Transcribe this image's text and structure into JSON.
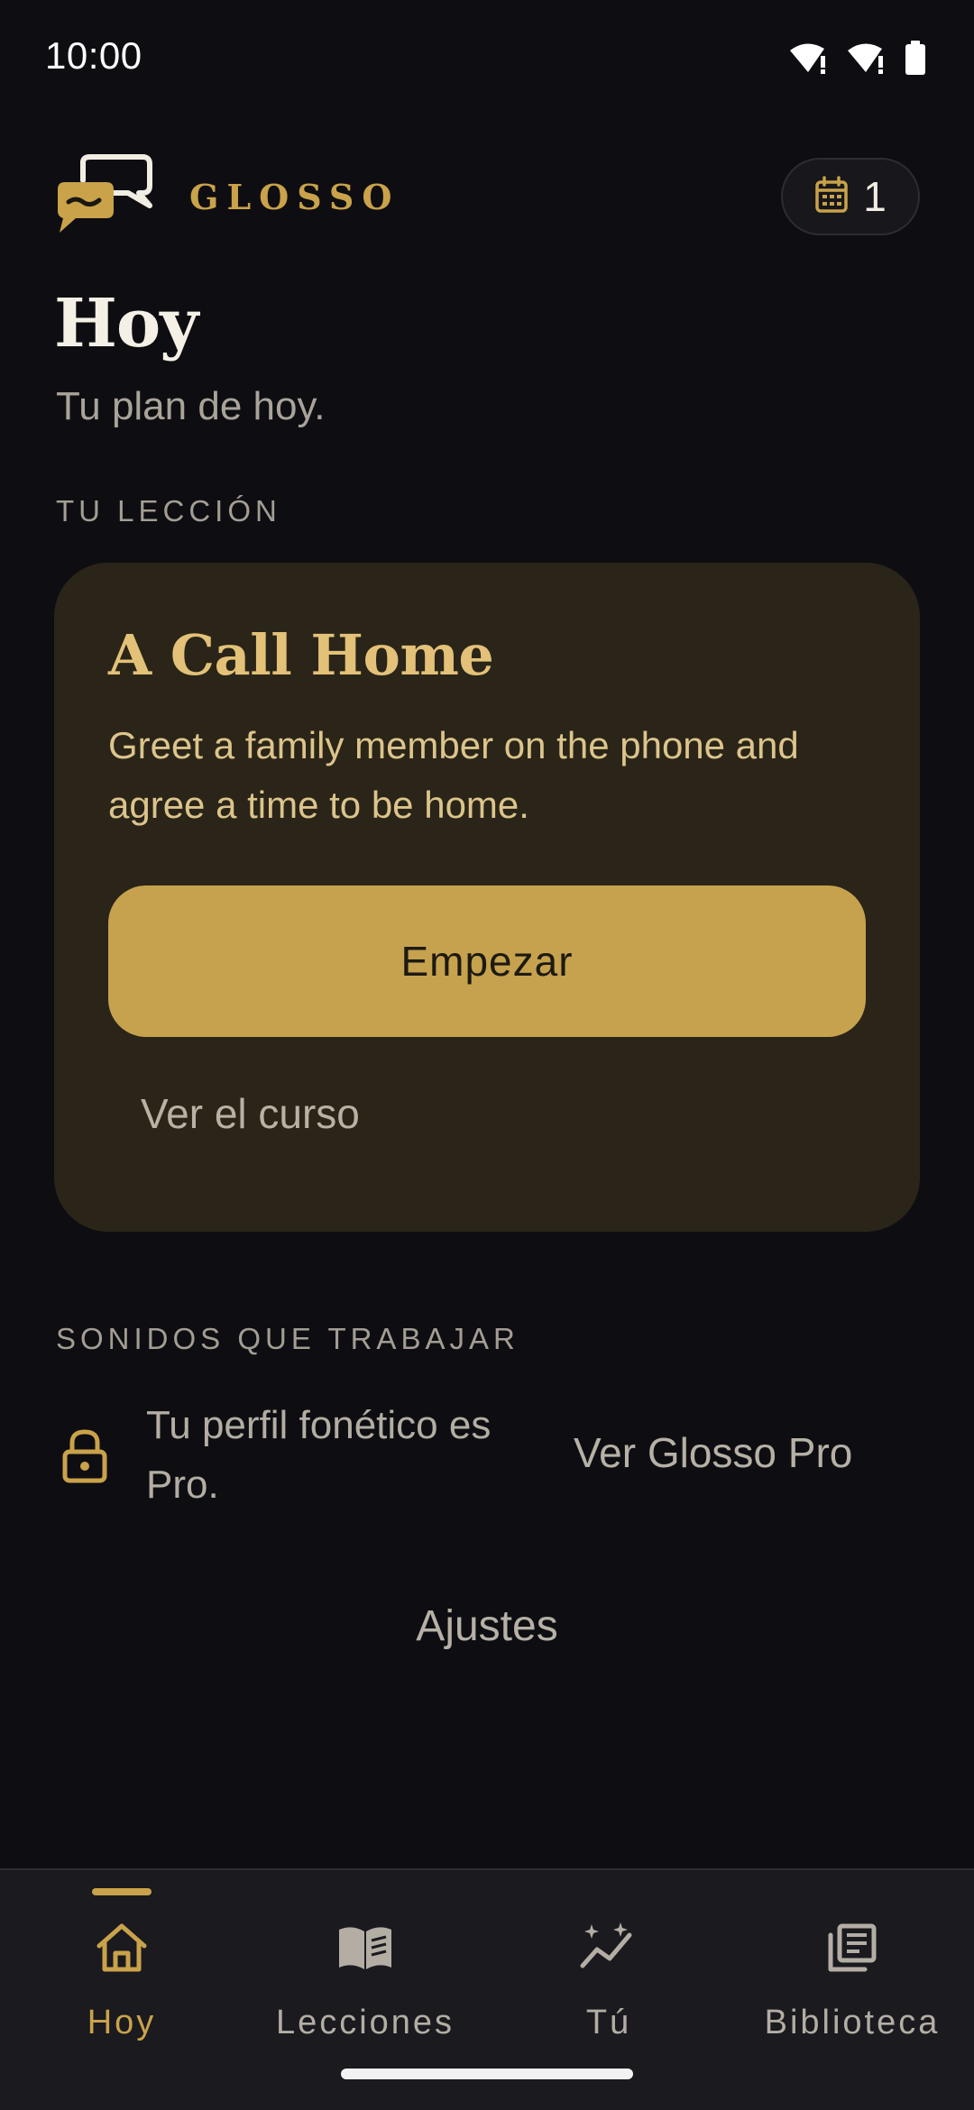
{
  "status_bar": {
    "time": "10:00",
    "icons": [
      "wifi-alert-icon",
      "signal-alert-icon",
      "battery-icon"
    ]
  },
  "header": {
    "brand": "GLOSSO",
    "logo_icon": "chat-bubbles-icon",
    "streak_icon": "calendar-icon",
    "streak_count": "1"
  },
  "page": {
    "title": "Hoy",
    "subtitle": "Tu plan de hoy."
  },
  "lesson_section": {
    "label": "TU LECCIÓN",
    "title": "A Call Home",
    "description": "Greet a family member on the phone and agree a time to be home.",
    "start_label": "Empezar",
    "course_link": "Ver el curso"
  },
  "sounds_section": {
    "label": "SONIDOS QUE TRABAJAR",
    "lock_icon": "lock-icon",
    "pro_text": "Tu perfil fonético es Pro.",
    "pro_link": "Ver Glosso Pro"
  },
  "settings_label": "Ajustes",
  "bottom_nav": {
    "items": [
      {
        "label": "Hoy",
        "icon": "home-icon",
        "active": true
      },
      {
        "label": "Lecciones",
        "icon": "book-icon",
        "active": false
      },
      {
        "label": "Tú",
        "icon": "progress-sparkle-icon",
        "active": false
      },
      {
        "label": "Biblioteca",
        "icon": "library-icon",
        "active": false
      }
    ]
  },
  "colors": {
    "background": "#0e0e12",
    "accent": "#c9a24a",
    "card": "#2a2518",
    "button": "#c6a24e",
    "nav_bg": "#1a1a1f"
  }
}
